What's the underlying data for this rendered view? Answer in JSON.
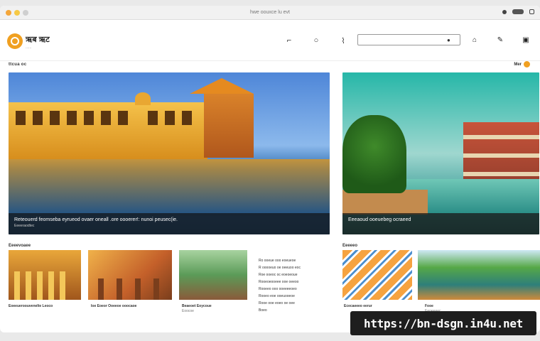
{
  "window": {
    "title": "hwe oouxce lu evt"
  },
  "header": {
    "logo_text": "ऋब ऋट",
    "logo_sub": "......",
    "search_placeholder": ""
  },
  "section": {
    "label": "ttcua oc",
    "see_all": "Mer"
  },
  "heroes": [
    {
      "caption": "Reteouerd feomseba eyrueod ovaer oneall  .ore oooerer!: nunoi peusec(ie.",
      "sub": "Eeeeraodtec"
    },
    {
      "caption": "Eeeaoud ooeuebeg  ocraeed",
      "sub": ""
    }
  ],
  "row_labels": {
    "left": "Eeeevoaee",
    "right": "Eeeeeo"
  },
  "thumbs": [
    {
      "title": "Eoeeueroouvenelte Leoco",
      "sub": ""
    },
    {
      "title": "Ioe  Eoeor Ooeeoe ooocaoe",
      "sub": ""
    },
    {
      "title": "Beaeoet Eoycoue",
      "sub": "Eoocoe"
    },
    {
      "title": "Ececaeeeo eerur",
      "sub": ""
    },
    {
      "title": "Fooe",
      "sub": "Eeoeeeec"
    }
  ],
  "text_block": [
    "Ro ooeue ooo eoeueoe",
    "R ooooeuo oe oeeuoo eoc",
    "Roe ooeoc oc eoeoeoue",
    "Rooeoeooeee ooe oeeoo",
    "Rooeeo ooo ooeeeeoeo",
    "Rooeo eoe ooeuooeoe",
    "Rooe ooe eoeo oe oee",
    "Boeo"
  ],
  "watermark": "https://bn-dsgn.in4u.net"
}
